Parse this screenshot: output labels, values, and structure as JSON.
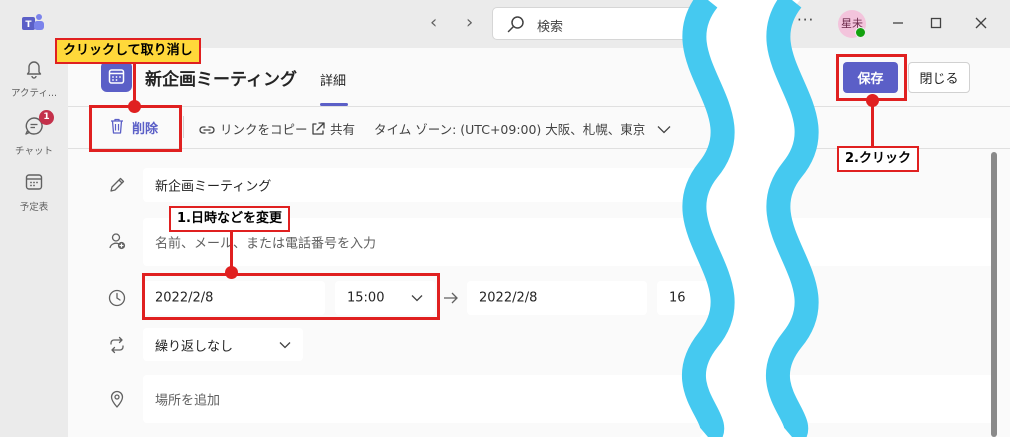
{
  "topbar": {
    "search_placeholder": "検索",
    "more": "···",
    "avatar_initials": "星未",
    "nav_back": "‹",
    "nav_forward": "›"
  },
  "rail": {
    "items": [
      {
        "label": "アクティ..."
      },
      {
        "label": "チャット",
        "badge": "1"
      },
      {
        "label": "予定表"
      }
    ]
  },
  "header": {
    "title": "新企画ミーティング",
    "tab": "詳細",
    "save_label": "保存",
    "close_label": "閉じる"
  },
  "toolbar": {
    "delete_label": "削除",
    "copy_link_label": "リンクをコピー",
    "share_label": "共有",
    "timezone_label": "タイム ゾーン: (UTC+09:00) 大阪、札幌、東京"
  },
  "form": {
    "title_value": "新企画ミーティング",
    "attendees_placeholder": "名前、メール、または電話番号を入力",
    "start_date": "2022/2/8",
    "start_time": "15:00",
    "end_date": "2022/2/8",
    "end_time_partial": "16",
    "repeat_value": "繰り返しなし",
    "location_placeholder": "場所を追加"
  },
  "annotations": {
    "cancel_note": "クリックして取り消し",
    "step1": "1.日時などを変更",
    "step2": "2.クリック"
  },
  "colors": {
    "accent": "#5b5fc7",
    "annotation_red": "#e02020",
    "annotation_yellow": "#ffd83a",
    "wave_blue": "#45c9f0"
  }
}
